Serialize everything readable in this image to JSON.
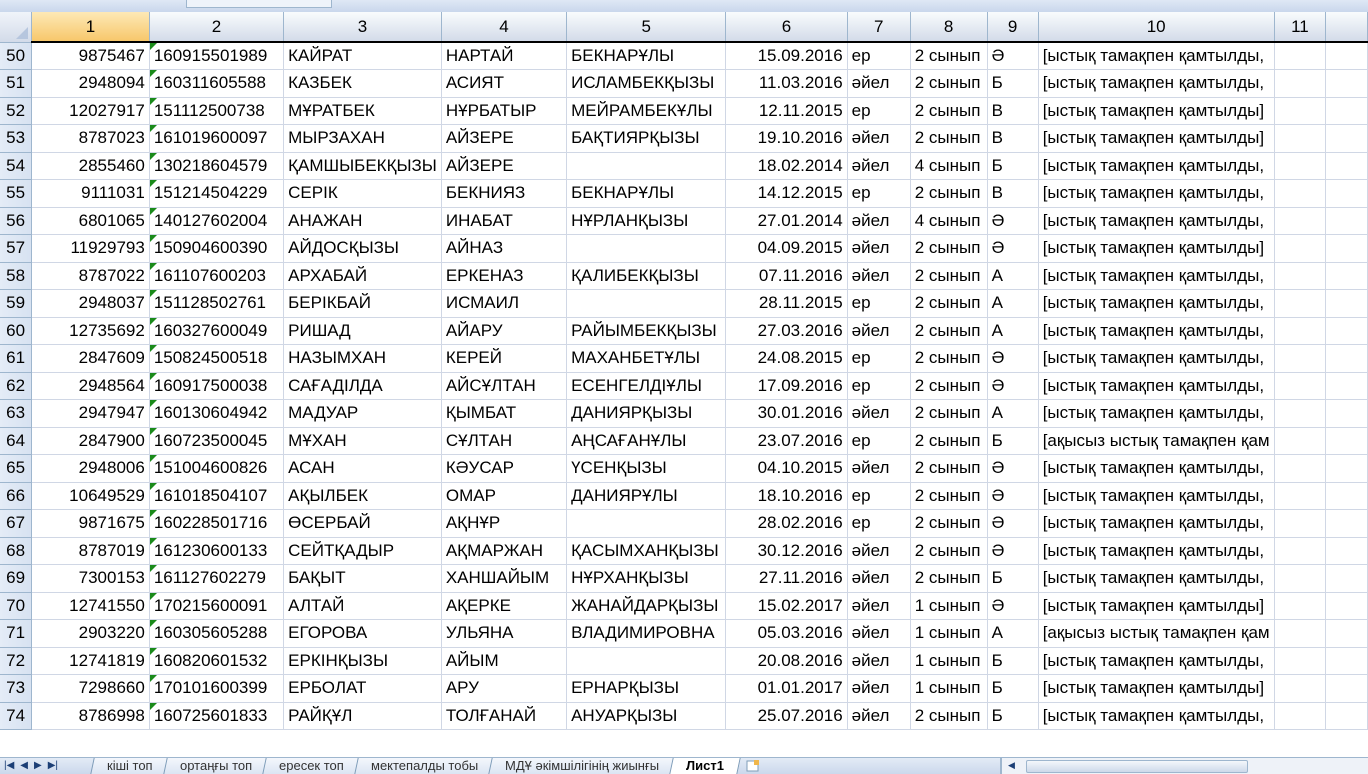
{
  "columns": [
    "1",
    "2",
    "3",
    "4",
    "5",
    "6",
    "7",
    "8",
    "9",
    "10",
    "11"
  ],
  "rows": [
    {
      "num": "50",
      "c": [
        "9875467",
        "160915501989",
        "КАЙРАТ",
        "НАРТАЙ",
        "БЕКНАРҰЛЫ",
        "15.09.2016",
        "ер",
        "2 сынып",
        "Ә",
        "[ыстық тамақпен қамтылды,"
      ]
    },
    {
      "num": "51",
      "c": [
        "2948094",
        "160311605588",
        "КАЗБЕК",
        "АСИЯТ",
        "ИСЛАМБЕКҚЫЗЫ",
        "11.03.2016",
        "әйел",
        "2 сынып",
        "Б",
        "[ыстық тамақпен қамтылды,"
      ]
    },
    {
      "num": "52",
      "c": [
        "12027917",
        "151112500738",
        "МҰРАТБЕК",
        "НҰРБАТЫР",
        "МЕЙРАМБЕКҰЛЫ",
        "12.11.2015",
        "ер",
        "2 сынып",
        "В",
        "[ыстық тамақпен қамтылды]"
      ]
    },
    {
      "num": "53",
      "c": [
        "8787023",
        "161019600097",
        "МЫРЗАХАН",
        "АЙЗЕРЕ",
        "БАҚТИЯРҚЫЗЫ",
        "19.10.2016",
        "әйел",
        "2 сынып",
        "В",
        "[ыстық тамақпен қамтылды]"
      ]
    },
    {
      "num": "54",
      "c": [
        "2855460",
        "130218604579",
        "ҚАМШЫБЕКҚЫЗЫ",
        "АЙЗЕРЕ",
        "",
        "18.02.2014",
        "әйел",
        "4 сынып",
        "Б",
        "[ыстық тамақпен қамтылды,"
      ]
    },
    {
      "num": "55",
      "c": [
        "9111031",
        "151214504229",
        "СЕРІК",
        "БЕКНИЯЗ",
        "БЕКНАРҰЛЫ",
        "14.12.2015",
        "ер",
        "2 сынып",
        "В",
        "[ыстық тамақпен қамтылды,"
      ]
    },
    {
      "num": "56",
      "c": [
        "6801065",
        "140127602004",
        "АНАЖАН",
        "ИНАБАТ",
        "НҰРЛАНҚЫЗЫ",
        "27.01.2014",
        "әйел",
        "4 сынып",
        "Ә",
        "[ыстық тамақпен қамтылды,"
      ]
    },
    {
      "num": "57",
      "c": [
        "11929793",
        "150904600390",
        "АЙДОСҚЫЗЫ",
        "АЙНАЗ",
        "",
        "04.09.2015",
        "әйел",
        "2 сынып",
        "Ә",
        "[ыстық тамақпен қамтылды]"
      ]
    },
    {
      "num": "58",
      "c": [
        "8787022",
        "161107600203",
        "АРХАБАЙ",
        "ЕРКЕНАЗ",
        "ҚАЛИБЕКҚЫЗЫ",
        "07.11.2016",
        "әйел",
        "2 сынып",
        "А",
        "[ыстық тамақпен қамтылды,"
      ]
    },
    {
      "num": "59",
      "c": [
        "2948037",
        "151128502761",
        "БЕРІКБАЙ",
        "ИСМАИЛ",
        "",
        "28.11.2015",
        "ер",
        "2 сынып",
        "А",
        "[ыстық тамақпен қамтылды,"
      ]
    },
    {
      "num": "60",
      "c": [
        "12735692",
        "160327600049",
        "РИШАД",
        "АЙАРУ",
        "РАЙЫМБЕКҚЫЗЫ",
        "27.03.2016",
        "әйел",
        "2 сынып",
        "А",
        "[ыстық тамақпен қамтылды,"
      ]
    },
    {
      "num": "61",
      "c": [
        "2847609",
        "150824500518",
        "НАЗЫМХАН",
        "КЕРЕЙ",
        "МАХАНБЕТҰЛЫ",
        "24.08.2015",
        "ер",
        "2 сынып",
        "Ә",
        "[ыстық тамақпен қамтылды,"
      ]
    },
    {
      "num": "62",
      "c": [
        "2948564",
        "160917500038",
        "САҒАДІЛДА",
        "АЙСҰЛТАН",
        "ЕСЕНГЕЛДІҰЛЫ",
        "17.09.2016",
        "ер",
        "2 сынып",
        "Ә",
        "[ыстық тамақпен қамтылды,"
      ]
    },
    {
      "num": "63",
      "c": [
        "2947947",
        "160130604942",
        "МАДУАР",
        "ҚЫМБАТ",
        "ДАНИЯРҚЫЗЫ",
        "30.01.2016",
        "әйел",
        "2 сынып",
        "А",
        "[ыстық тамақпен қамтылды,"
      ]
    },
    {
      "num": "64",
      "c": [
        "2847900",
        "160723500045",
        "МҰХАН",
        "СҰЛТАН",
        "АҢСАҒАНҰЛЫ",
        "23.07.2016",
        "ер",
        "2 сынып",
        "Б",
        "[ақысыз ыстық тамақпен қам"
      ]
    },
    {
      "num": "65",
      "c": [
        "2948006",
        "151004600826",
        "АСАН",
        "КӘУСАР",
        "ҮСЕНҚЫЗЫ",
        "04.10.2015",
        "әйел",
        "2 сынып",
        "Ә",
        "[ыстық тамақпен қамтылды,"
      ]
    },
    {
      "num": "66",
      "c": [
        "10649529",
        "161018504107",
        "АҚЫЛБЕК",
        "ОМАР",
        "ДАНИЯРҰЛЫ",
        "18.10.2016",
        "ер",
        "2 сынып",
        "Ә",
        "[ыстық тамақпен қамтылды,"
      ]
    },
    {
      "num": "67",
      "c": [
        "9871675",
        "160228501716",
        "ӨСЕРБАЙ",
        "АҚНҰР",
        "",
        "28.02.2016",
        "ер",
        "2 сынып",
        "Ә",
        "[ыстық тамақпен қамтылды,"
      ]
    },
    {
      "num": "68",
      "c": [
        "8787019",
        "161230600133",
        "СЕЙТҚАДЫР",
        "АҚМАРЖАН",
        "ҚАСЫМХАНҚЫЗЫ",
        "30.12.2016",
        "әйел",
        "2 сынып",
        "Ә",
        "[ыстық тамақпен қамтылды,"
      ]
    },
    {
      "num": "69",
      "c": [
        "7300153",
        "161127602279",
        "БАҚЫТ",
        "ХАНШАЙЫМ",
        "НҰРХАНҚЫЗЫ",
        "27.11.2016",
        "әйел",
        "2 сынып",
        "Б",
        "[ыстық тамақпен қамтылды,"
      ]
    },
    {
      "num": "70",
      "c": [
        "12741550",
        "170215600091",
        "АЛТАЙ",
        "АҚЕРКЕ",
        "ЖАНАЙДАРҚЫЗЫ",
        "15.02.2017",
        "әйел",
        "1 сынып",
        "Ә",
        "[ыстық тамақпен қамтылды]"
      ]
    },
    {
      "num": "71",
      "c": [
        "2903220",
        "160305605288",
        "ЕГОРОВА",
        "УЛЬЯНА",
        "ВЛАДИМИРОВНА",
        "05.03.2016",
        "әйел",
        "1 сынып",
        "А",
        "[ақысыз ыстық тамақпен қам"
      ]
    },
    {
      "num": "72",
      "c": [
        "12741819",
        "160820601532",
        "ЕРКІНҚЫЗЫ",
        "АЙЫМ",
        "",
        "20.08.2016",
        "әйел",
        "1 сынып",
        "Б",
        "[ыстық тамақпен қамтылды,"
      ]
    },
    {
      "num": "73",
      "c": [
        "7298660",
        "170101600399",
        "ЕРБОЛАТ",
        "АРУ",
        "ЕРНАРҚЫЗЫ",
        "01.01.2017",
        "әйел",
        "1 сынып",
        "Б",
        "[ыстық тамақпен қамтылды]"
      ]
    },
    {
      "num": "74",
      "c": [
        "8786998",
        "160725601833",
        "РАЙҚҰЛ",
        "ТОЛҒАНАЙ",
        "АНУАРҚЫЗЫ",
        "25.07.2016",
        "әйел",
        "2 сынып",
        "Б",
        "[ыстық тамақпен қамтылды,"
      ]
    }
  ],
  "sheet_tabs": [
    {
      "label": "кіші топ",
      "active": false
    },
    {
      "label": "ортаңғы топ",
      "active": false
    },
    {
      "label": "ересек топ",
      "active": false
    },
    {
      "label": "мектепалды тобы",
      "active": false
    },
    {
      "label": "МДҰ әкімшілігінің жиынғы",
      "active": false
    },
    {
      "label": "Лист1",
      "active": true
    }
  ],
  "colors": {
    "grid_line": "#d0d7e5",
    "header_bg": "#d3dbe9",
    "selected_header": "#f7c76b",
    "text_flag": "#1a8a1a"
  },
  "icons": {
    "nav": [
      "first-sheet-icon",
      "prev-sheet-icon",
      "next-sheet-icon",
      "last-sheet-icon"
    ],
    "new_sheet": "new-sheet-icon"
  }
}
